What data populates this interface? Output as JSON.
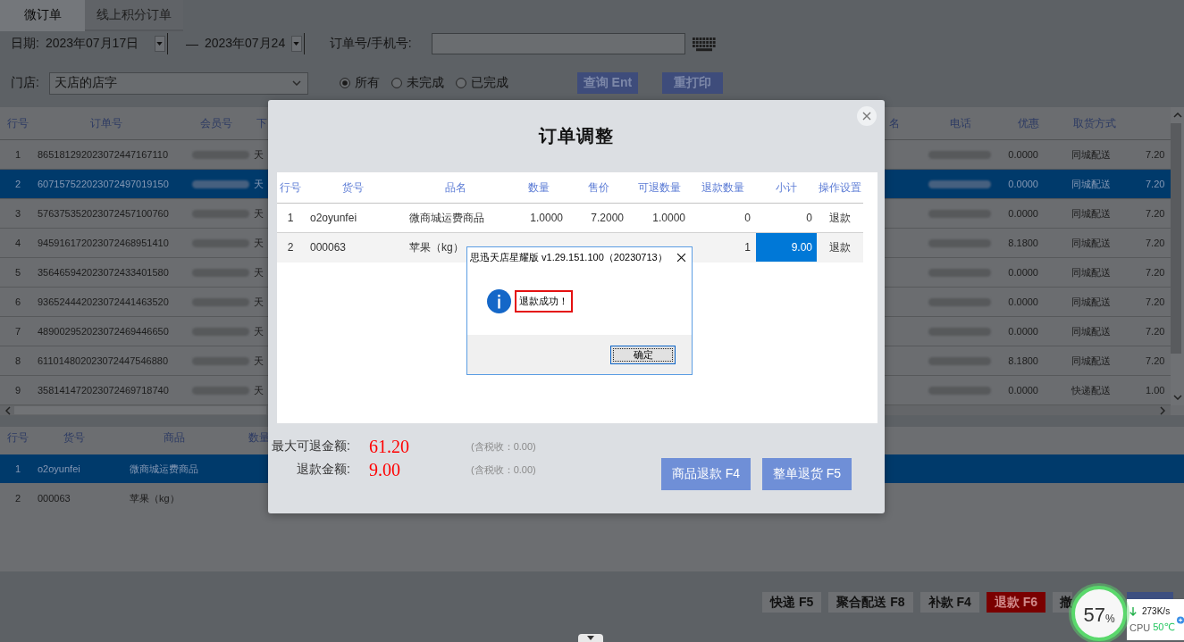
{
  "tabs": [
    {
      "label": "微订单",
      "selected": true
    },
    {
      "label": "线上积分订单",
      "selected": false
    }
  ],
  "filters": {
    "date_label": "日期:",
    "date_from": "2023年07月17日",
    "date_separator": "—",
    "date_to": "2023年07月24",
    "search_label": "订单号/手机号:",
    "store_label": "门店:",
    "store": "天店的店字",
    "status_options": [
      {
        "label": "所有",
        "selected": true
      },
      {
        "label": "未完成",
        "selected": false
      },
      {
        "label": "已完成",
        "selected": false
      }
    ],
    "buttons": [
      "查询 Ent",
      "重打印"
    ]
  },
  "orders_table": {
    "columns": [
      "行号",
      "订单号",
      "会员号",
      "下",
      "名",
      "电话",
      "优惠",
      "取货方式"
    ],
    "rows": [
      {
        "no": "1",
        "order_no": "865181292023072447167110",
        "column_4": "天",
        "discount": "0.0000",
        "pickup": "同城配送",
        "column_10": "7.20",
        "selected": false
      },
      {
        "no": "2",
        "order_no": "607157522023072497019150",
        "column_4": "天",
        "discount": "0.0000",
        "pickup": "同城配送",
        "column_10": "7.20",
        "selected": true
      },
      {
        "no": "3",
        "order_no": "576375352023072457100760",
        "column_4": "天",
        "discount": "0.0000",
        "pickup": "同城配送",
        "column_10": "7.20",
        "selected": false
      },
      {
        "no": "4",
        "order_no": "945916172023072468951410",
        "column_4": "天",
        "discount": "8.1800",
        "pickup": "同城配送",
        "column_10": "7.20",
        "selected": false
      },
      {
        "no": "5",
        "order_no": "356465942023072433401580",
        "column_4": "天",
        "discount": "0.0000",
        "pickup": "同城配送",
        "column_10": "7.20",
        "selected": false
      },
      {
        "no": "6",
        "order_no": "936524442023072441463520",
        "column_4": "天",
        "discount": "0.0000",
        "pickup": "同城配送",
        "column_10": "7.20",
        "selected": false
      },
      {
        "no": "7",
        "order_no": "489002952023072469446650",
        "column_4": "天",
        "discount": "0.0000",
        "pickup": "同城配送",
        "column_10": "7.20",
        "selected": false
      },
      {
        "no": "8",
        "order_no": "611014802023072447546880",
        "column_4": "天",
        "discount": "8.1800",
        "pickup": "同城配送",
        "column_10": "7.20",
        "selected": false
      },
      {
        "no": "9",
        "order_no": "358141472023072469718740",
        "column_4": "天",
        "discount": "0.0000",
        "pickup": "快递配送",
        "column_10": "1.00",
        "selected": false
      }
    ]
  },
  "items_table": {
    "columns": [
      "行号",
      "货号",
      "商品",
      "数量"
    ],
    "rows": [
      {
        "no": "1",
        "sku": "o2oyunfei",
        "product": "微商城运费商品",
        "selected": true
      },
      {
        "no": "2",
        "sku": "000063",
        "product": "苹果（kg）",
        "selected": false
      }
    ]
  },
  "action_buttons": [
    {
      "label": "快递 F5",
      "kind": "plain"
    },
    {
      "label": "聚合配送 F8",
      "kind": "plain"
    },
    {
      "label": "补款 F4",
      "kind": "plain"
    },
    {
      "label": "退款 F6",
      "kind": "danger"
    },
    {
      "label": "撤",
      "kind": "partial"
    },
    {
      "kind": "primary"
    }
  ],
  "dialog": {
    "title": "订单调整",
    "table": {
      "columns": [
        "行号",
        "货号",
        "品名",
        "数量",
        "售价",
        "可退数量",
        "退款数量",
        "小计",
        "操作设置"
      ],
      "rows": [
        {
          "no": "1",
          "sku": "o2oyunfei",
          "name": "微商城运费商品",
          "qty": "1.0000",
          "price": "7.2000",
          "refundable_qty": "1.0000",
          "refund_qty": "0",
          "subtotal": "0",
          "action": "退款",
          "selected": false,
          "subtotal_selected": false
        },
        {
          "no": "2",
          "sku": "000063",
          "name": "苹果（kg）",
          "refund_qty": "1",
          "subtotal": "9.00",
          "action": "退款",
          "selected": true,
          "subtotal_selected": true
        }
      ]
    },
    "totals": [
      {
        "label": "最大可退金额:",
        "amount": "61.20",
        "tax_note": "(含税收：0.00)"
      },
      {
        "label": "退款金额:",
        "amount": "9.00",
        "tax_note": "(含税收：0.00)"
      }
    ],
    "buttons": [
      "商品退款 F4",
      "整单退货 F5"
    ]
  },
  "message_box": {
    "title": "思迅天店星耀版 v1.29.151.100（20230713）",
    "message": "退款成功！",
    "highlighted": true,
    "button": "确定"
  },
  "system_monitor": {
    "usage": "57",
    "usage_unit": "%",
    "net_speed": "273K/s",
    "cpu_label": "CPU",
    "cpu_temp": "50℃"
  }
}
